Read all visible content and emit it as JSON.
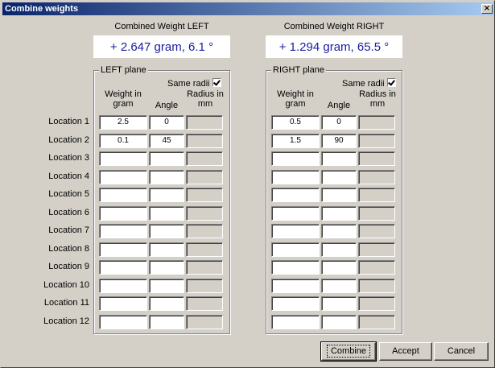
{
  "window": {
    "title": "Combine weights",
    "close_glyph": "×"
  },
  "left": {
    "combined_label": "Combined Weight LEFT",
    "combined_value": "+ 2.647 gram, 6.1 °",
    "plane_title": "LEFT plane",
    "same_radii_label": "Same radii",
    "same_radii_checked": true,
    "col_weight": "Weight in\ngram",
    "col_angle": "Angle",
    "col_radius": "Radius in\nmm",
    "rows": [
      {
        "weight": "2.5",
        "angle": "0",
        "radius": ""
      },
      {
        "weight": "0.1",
        "angle": "45",
        "radius": ""
      },
      {
        "weight": "",
        "angle": "",
        "radius": ""
      },
      {
        "weight": "",
        "angle": "",
        "radius": ""
      },
      {
        "weight": "",
        "angle": "",
        "radius": ""
      },
      {
        "weight": "",
        "angle": "",
        "radius": ""
      },
      {
        "weight": "",
        "angle": "",
        "radius": ""
      },
      {
        "weight": "",
        "angle": "",
        "radius": ""
      },
      {
        "weight": "",
        "angle": "",
        "radius": ""
      },
      {
        "weight": "",
        "angle": "",
        "radius": ""
      },
      {
        "weight": "",
        "angle": "",
        "radius": ""
      },
      {
        "weight": "",
        "angle": "",
        "radius": ""
      }
    ]
  },
  "right": {
    "combined_label": "Combined Weight RIGHT",
    "combined_value": "+ 1.294 gram, 65.5 °",
    "plane_title": "RIGHT plane",
    "same_radii_label": "Same radii",
    "same_radii_checked": true,
    "col_weight": "Weight in\ngram",
    "col_angle": "Angle",
    "col_radius": "Radius in\nmm",
    "rows": [
      {
        "weight": "0.5",
        "angle": "0",
        "radius": ""
      },
      {
        "weight": "1.5",
        "angle": "90",
        "radius": ""
      },
      {
        "weight": "",
        "angle": "",
        "radius": ""
      },
      {
        "weight": "",
        "angle": "",
        "radius": ""
      },
      {
        "weight": "",
        "angle": "",
        "radius": ""
      },
      {
        "weight": "",
        "angle": "",
        "radius": ""
      },
      {
        "weight": "",
        "angle": "",
        "radius": ""
      },
      {
        "weight": "",
        "angle": "",
        "radius": ""
      },
      {
        "weight": "",
        "angle": "",
        "radius": ""
      },
      {
        "weight": "",
        "angle": "",
        "radius": ""
      },
      {
        "weight": "",
        "angle": "",
        "radius": ""
      },
      {
        "weight": "",
        "angle": "",
        "radius": ""
      }
    ]
  },
  "location_labels": [
    "Location 1",
    "Location 2",
    "Location 3",
    "Location 4",
    "Location 5",
    "Location 6",
    "Location 7",
    "Location 8",
    "Location 9",
    "Location 10",
    "Location 11",
    "Location 12"
  ],
  "buttons": {
    "combine": "Combine",
    "accept": "Accept",
    "cancel": "Cancel"
  }
}
